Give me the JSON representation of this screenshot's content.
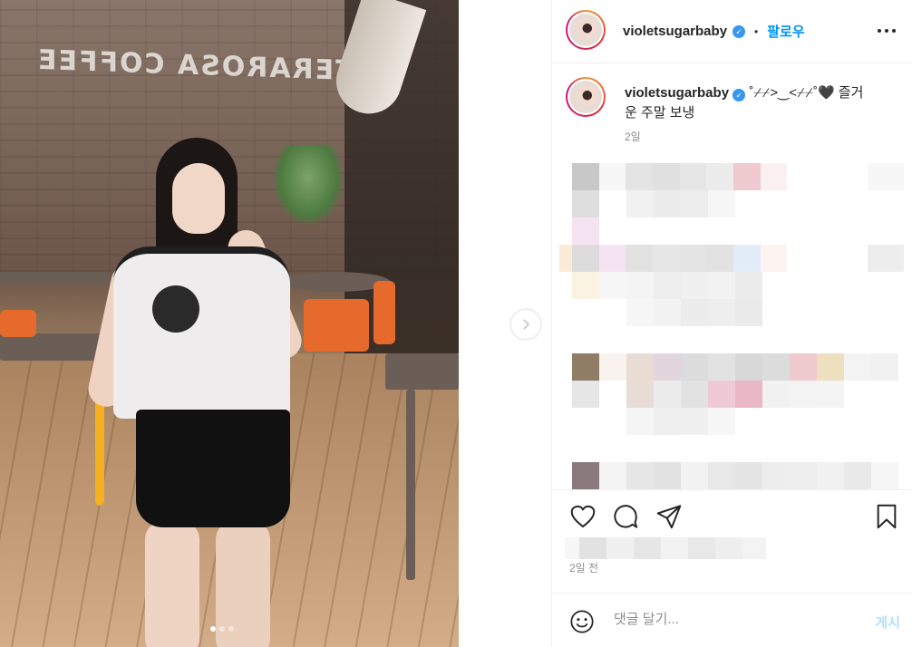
{
  "photo": {
    "wall_sign": "TERAROSA COFFEE",
    "page_count": 3,
    "active_page": 1
  },
  "header": {
    "username": "violetsugarbaby",
    "separator": "•",
    "follow_label": "팔로우",
    "more_icon": "more-horizontal-icon"
  },
  "caption": {
    "username": "violetsugarbaby",
    "text_line1": "˚⌿⌿>‿<⌿⌿˚🖤 즐거",
    "text_line2": "운 주말 보냉",
    "time": "2일"
  },
  "actions": {
    "like_icon": "heart-icon",
    "comment_icon": "comment-icon",
    "share_icon": "send-icon",
    "save_icon": "bookmark-icon",
    "time_ago": "2일 전"
  },
  "comment_bar": {
    "emoji_icon": "smile-icon",
    "placeholder": "댓글 달기...",
    "post_label": "게시"
  }
}
